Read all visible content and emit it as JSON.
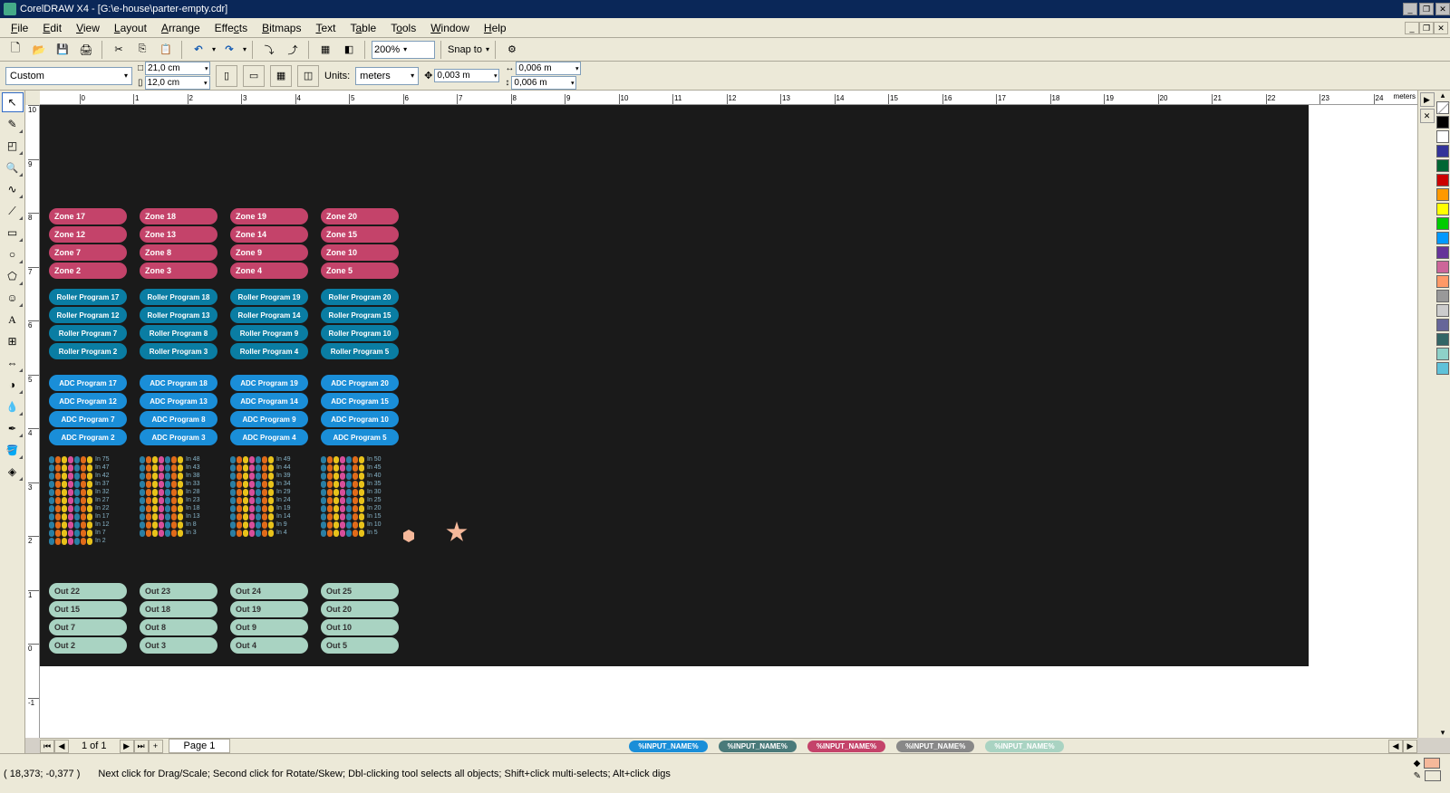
{
  "title": "CorelDRAW X4 - [G:\\e-house\\parter-empty.cdr]",
  "menus": [
    "File",
    "Edit",
    "View",
    "Layout",
    "Arrange",
    "Effects",
    "Bitmaps",
    "Text",
    "Table",
    "Tools",
    "Window",
    "Help"
  ],
  "toolbar": {
    "zoom": "200%",
    "snap": "Snap to"
  },
  "propbar": {
    "paper": "Custom",
    "w": "21,0 cm",
    "h": "12,0 cm",
    "units_label": "Units:",
    "units": "meters",
    "nudge": "0,003 m",
    "dupx": "0,006 m",
    "dupy": "0,006 m"
  },
  "ruler_unit": "meters",
  "canvas": {
    "zones": [
      [
        "Zone 17",
        "Zone 18",
        "Zone 19",
        "Zone 20"
      ],
      [
        "Zone 12",
        "Zone 13",
        "Zone 14",
        "Zone 15"
      ],
      [
        "Zone 7",
        "Zone 8",
        "Zone 9",
        "Zone 10"
      ],
      [
        "Zone 2",
        "Zone 3",
        "Zone 4",
        "Zone 5"
      ]
    ],
    "rollers": [
      [
        "Roller Program 17",
        "Roller Program 18",
        "Roller Program 19",
        "Roller Program 20"
      ],
      [
        "Roller Program 12",
        "Roller Program 13",
        "Roller Program 14",
        "Roller Program 15"
      ],
      [
        "Roller Program 7",
        "Roller Program 8",
        "Roller Program 9",
        "Roller Program 10"
      ],
      [
        "Roller Program 2",
        "Roller Program 3",
        "Roller Program 4",
        "Roller Program 5"
      ]
    ],
    "adcs": [
      [
        "ADC Program 17",
        "ADC Program 18",
        "ADC Program 19",
        "ADC Program 20"
      ],
      [
        "ADC Program 12",
        "ADC Program 13",
        "ADC Program 14",
        "ADC Program 15"
      ],
      [
        "ADC Program 7",
        "ADC Program 8",
        "ADC Program 9",
        "ADC Program 10"
      ],
      [
        "ADC Program 2",
        "ADC Program 3",
        "ADC Program 4",
        "ADC Program 5"
      ]
    ],
    "outs": [
      [
        "Out 22",
        "Out 23",
        "Out 24",
        "Out 25"
      ],
      [
        "Out 15",
        "Out 18",
        "Out 19",
        "Out 20"
      ],
      [
        "Out 7",
        "Out 8",
        "Out 9",
        "Out 10"
      ],
      [
        "Out 2",
        "Out 3",
        "Out 4",
        "Out 5"
      ]
    ],
    "ins": [
      [
        "In 75",
        "In 47",
        "In 42",
        "In 37",
        "In 32",
        "In 27",
        "In 22",
        "In 17",
        "In 12",
        "In 7",
        "In 2"
      ],
      [
        "In 48",
        "In 43",
        "In 38",
        "In 33",
        "In 28",
        "In 23",
        "In 18",
        "In 13",
        "In 8",
        "In 3"
      ],
      [
        "In 49",
        "In 44",
        "In 39",
        "In 34",
        "In 29",
        "In 24",
        "In 19",
        "In 14",
        "In 9",
        "In 4"
      ],
      [
        "In 50",
        "In 45",
        "In 40",
        "In 35",
        "In 30",
        "In 25",
        "In 20",
        "In 15",
        "In 10",
        "In 5"
      ]
    ],
    "tags": [
      "%INPUT_NAME%",
      "%INPUT_NAME%",
      "%INPUT_NAME%",
      "%INPUT_NAME%",
      "%INPUT_NAME%"
    ]
  },
  "page": {
    "count": "1 of 1",
    "tab": "Page 1"
  },
  "status": {
    "coords": "( 18,373; -0,377 )",
    "hint": "Next click for Drag/Scale; Second click for Rotate/Skew; Dbl-clicking tool selects all objects; Shift+click multi-selects; Alt+click digs",
    "fill_color": "#f5b89a"
  },
  "palette": [
    "#000000",
    "#ffffff",
    "#333399",
    "#006633",
    "#cc0000",
    "#ff9900",
    "#ffff00",
    "#00cc00",
    "#0099ff",
    "#663399",
    "#cc6699",
    "#ff9966",
    "#999999",
    "#cccccc",
    "#666699",
    "#336666",
    "#8ed1c8",
    "#5fc2d9"
  ]
}
